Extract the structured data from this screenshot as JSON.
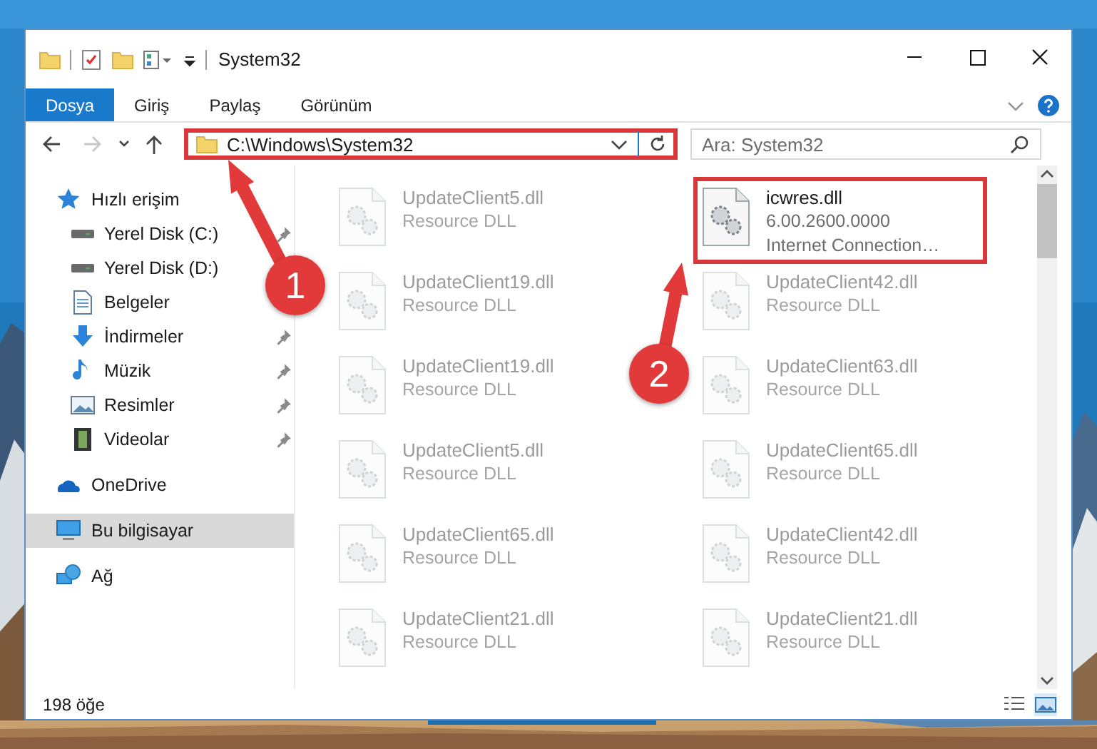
{
  "window": {
    "title": "System32"
  },
  "ribbon": {
    "tabs": [
      {
        "label": "Dosya",
        "selected": true
      },
      {
        "label": "Giriş",
        "selected": false
      },
      {
        "label": "Paylaş",
        "selected": false
      },
      {
        "label": "Görünüm",
        "selected": false
      }
    ]
  },
  "nav_buttons": [
    {
      "kind": "back",
      "disabled": false
    },
    {
      "kind": "forward",
      "disabled": true
    },
    {
      "kind": "recent",
      "disabled": false
    },
    {
      "kind": "up",
      "disabled": false
    }
  ],
  "address": {
    "path": "C:\\Windows\\System32",
    "highlighted": true
  },
  "search": {
    "placeholder": "Ara: System32"
  },
  "sidebar": {
    "items": [
      {
        "label": "Hızlı erişim",
        "kind": "star",
        "selected": false,
        "children": [
          {
            "label": "Yerel Disk (C:)",
            "kind": "drive",
            "pinned": true,
            "selected": false
          },
          {
            "label": "Yerel Disk (D:)",
            "kind": "drive",
            "pinned": false,
            "selected": false
          },
          {
            "label": "Belgeler",
            "kind": "documents",
            "pinned": false,
            "selected": false
          },
          {
            "label": "İndirmeler",
            "kind": "downloads",
            "pinned": true,
            "selected": false
          },
          {
            "label": "Müzik",
            "kind": "music",
            "pinned": true,
            "selected": false
          },
          {
            "label": "Resimler",
            "kind": "pictures",
            "pinned": true,
            "selected": false
          },
          {
            "label": "Videolar",
            "kind": "videos",
            "pinned": true,
            "selected": false
          }
        ]
      },
      {
        "label": "OneDrive",
        "kind": "cloud",
        "selected": false
      },
      {
        "label": "Bu bilgisayar",
        "kind": "computer",
        "selected": true
      },
      {
        "label": "Ağ",
        "kind": "network",
        "selected": false
      }
    ]
  },
  "files": [
    {
      "name": "UpdateClient5.dll",
      "details": [
        "Resource DLL"
      ],
      "faded": true,
      "highlighted": false
    },
    {
      "name": "icwres.dll",
      "details": [
        "6.00.2600.0000",
        "Internet Connection…"
      ],
      "faded": false,
      "highlighted": true
    },
    {
      "name": "UpdateClient19.dll",
      "details": [
        "Resource DLL"
      ],
      "faded": true,
      "highlighted": false
    },
    {
      "name": "UpdateClient42.dll",
      "details": [
        "Resource DLL"
      ],
      "faded": true,
      "highlighted": false
    },
    {
      "name": "UpdateClient19.dll",
      "details": [
        "Resource DLL"
      ],
      "faded": true,
      "highlighted": false
    },
    {
      "name": "UpdateClient63.dll",
      "details": [
        "Resource DLL"
      ],
      "faded": true,
      "highlighted": false
    },
    {
      "name": "UpdateClient5.dll",
      "details": [
        "Resource DLL"
      ],
      "faded": true,
      "highlighted": false
    },
    {
      "name": "UpdateClient65.dll",
      "details": [
        "Resource DLL"
      ],
      "faded": true,
      "highlighted": false
    },
    {
      "name": "UpdateClient65.dll",
      "details": [
        "Resource DLL"
      ],
      "faded": true,
      "highlighted": false
    },
    {
      "name": "UpdateClient42.dll",
      "details": [
        "Resource DLL"
      ],
      "faded": true,
      "highlighted": false
    },
    {
      "name": "UpdateClient21.dll",
      "details": [
        "Resource DLL"
      ],
      "faded": true,
      "highlighted": false
    },
    {
      "name": "UpdateClient21.dll",
      "details": [
        "Resource DLL"
      ],
      "faded": true,
      "highlighted": false
    }
  ],
  "status_bar": {
    "count": "198 öğe"
  },
  "annotations": [
    {
      "number": "1"
    },
    {
      "number": "2"
    }
  ]
}
